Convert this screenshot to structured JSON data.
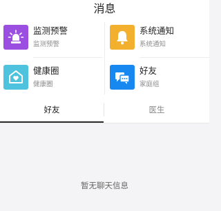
{
  "header": {
    "title": "消息"
  },
  "grid": {
    "items": [
      {
        "name": "监测预警",
        "sub": "监测预警",
        "icon": "alarm-siren-icon",
        "color": "#9b4fe0"
      },
      {
        "name": "系统通知",
        "sub": "系统通知",
        "icon": "bell-icon",
        "color": "#f2b02e"
      },
      {
        "name": "健康圈",
        "sub": "健康圈",
        "icon": "home-heart-icon",
        "color": "#4fc3de"
      },
      {
        "name": "好友",
        "sub": "家庭组",
        "icon": "chat-bubbles-icon",
        "color": "#1688f0"
      }
    ]
  },
  "tabs": [
    {
      "label": "好友",
      "active": true
    },
    {
      "label": "医生",
      "active": false
    }
  ],
  "empty_state": {
    "text": "暂无聊天信息"
  }
}
